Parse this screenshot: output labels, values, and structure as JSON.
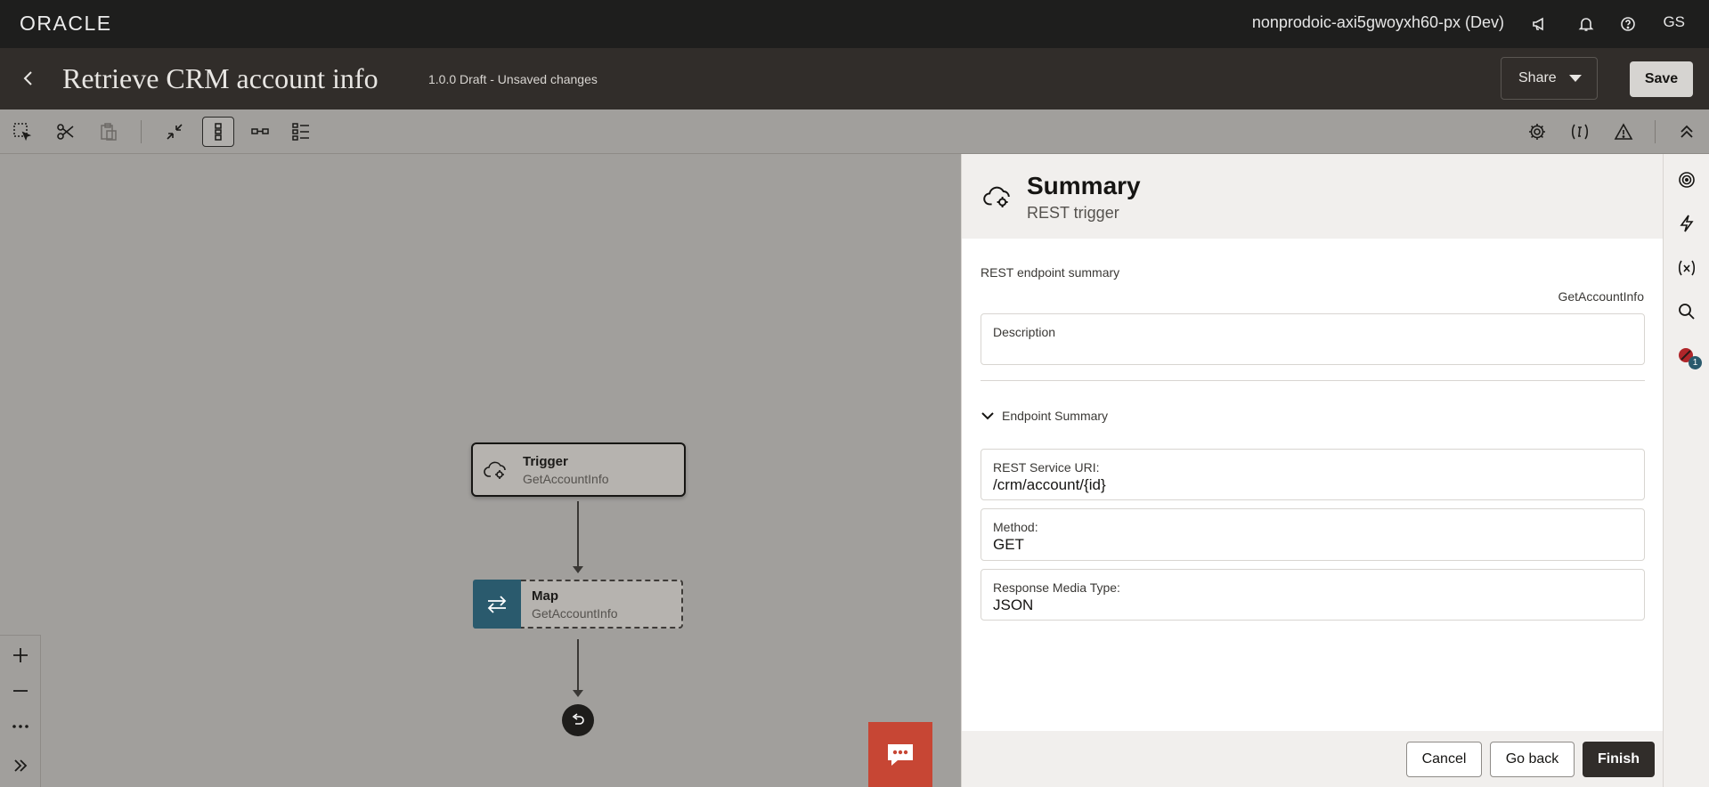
{
  "brand": {
    "logo_text": "ORACLE"
  },
  "topbar": {
    "environment": "nonprodoic-axi5gwoyxh60-px (Dev)",
    "user_initials": "GS"
  },
  "titlebar": {
    "title": "Retrieve CRM account info",
    "version": "1.0.0 Draft - Unsaved changes",
    "share_label": "Share",
    "save_label": "Save"
  },
  "canvas": {
    "nodes": [
      {
        "title": "Trigger",
        "subtitle": "GetAccountInfo"
      },
      {
        "title": "Map",
        "subtitle": "GetAccountInfo"
      }
    ]
  },
  "panel": {
    "title": "Summary",
    "subtitle": "REST trigger",
    "section_label": "REST endpoint summary",
    "endpoint_name": "GetAccountInfo",
    "description_label": "Description",
    "description_value": "",
    "collapse_label": "Endpoint Summary",
    "fields": [
      {
        "label": "REST Service URI:",
        "value": "/crm/account/{id}"
      },
      {
        "label": "Method:",
        "value": "GET"
      },
      {
        "label": "Response Media Type:",
        "value": "JSON"
      }
    ],
    "footer": {
      "cancel_label": "Cancel",
      "go_back_label": "Go back",
      "finish_label": "Finish"
    }
  },
  "rail": {
    "error_count": "1"
  },
  "colors": {
    "topbar": "#1e1e1d",
    "titlebar": "#312d2a",
    "canvas": "#a19f9c",
    "map_icon": "#2a5a6d",
    "chat": "#c74634"
  }
}
